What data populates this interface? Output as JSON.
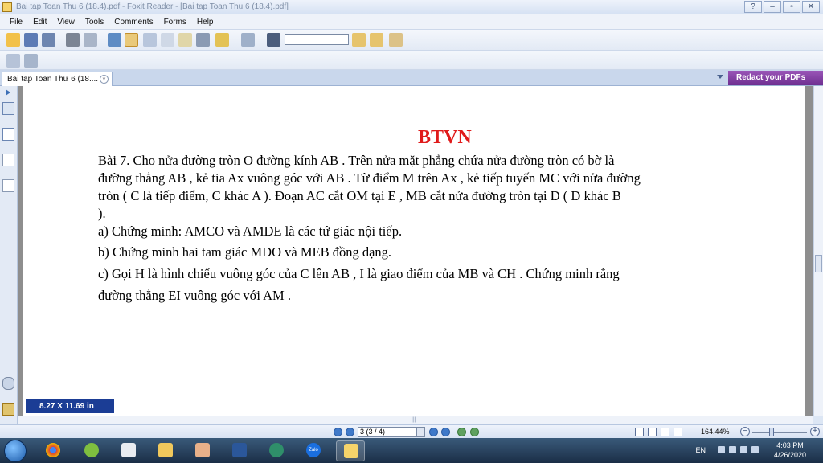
{
  "window": {
    "title": "Bai tap Toan Thu 6 (18.4).pdf - Foxit Reader - [Bai tap Toan Thu 6 (18.4).pdf]",
    "minimize": "–",
    "restore": "▫",
    "close": "✕",
    "help": "?"
  },
  "menu": {
    "items": [
      "File",
      "Edit",
      "View",
      "Tools",
      "Comments",
      "Forms",
      "Help"
    ]
  },
  "tabs": {
    "doc_tab_label": "Bai tap Toan Thư 6 (18....",
    "close_glyph": "×",
    "redact_banner": "Redact your PDFs"
  },
  "document": {
    "heading": "BTVN",
    "lines": [
      "Bài 7. Cho nửa đường tròn  O  đường kính  AB . Trên nửa mặt phẳng chứa nửa đường tròn có bờ là",
      "đường thẳng  AB , kẻ tia  Ax vuông góc với  AB . Từ điểm  M trên  Ax , kẻ tiếp tuyến  MC  với nửa đường",
      "tròn ( C  là tiếp điểm,  C  khác  A ). Đoạn  AC  cắt  OM  tại  E ,  MB cắt nửa đường tròn tại  D ( D  khác  B",
      ").",
      "a) Chứng minh:  AMCO  và  AMDE  là các tứ giác nội tiếp.",
      "b) Chứng minh hai tam giác  MDO  và  MEB  đồng dạng.",
      "c) Gọi  H  là hình chiếu vuông góc của  C  lên  AB ,  I  là giao điểm của  MB  và  CH . Chứng minh rằng",
      "đường thẳng  EI  vuông góc với  AM ."
    ]
  },
  "page_size_badge": "8.27 X 11.69 in",
  "statusbar": {
    "page_indicator": "3 (3 / 4)",
    "zoom": "164.44%",
    "zoom_minus": "−",
    "zoom_plus": "+"
  },
  "taskbar": {
    "language": "EN",
    "time": "4:03 PM",
    "date": "4/26/2020",
    "apps": [
      "chrome-icon",
      "app-icon",
      "media-player-icon",
      "file-explorer-icon",
      "user-icon",
      "word-icon",
      "app-icon-2",
      "zalo-icon",
      "foxit-icon"
    ],
    "zalo_label": "Zalo"
  },
  "colors": {
    "heading_red": "#e01b1b",
    "badge_blue": "#1b3d95",
    "redact_purple": "#7d3a9e"
  }
}
